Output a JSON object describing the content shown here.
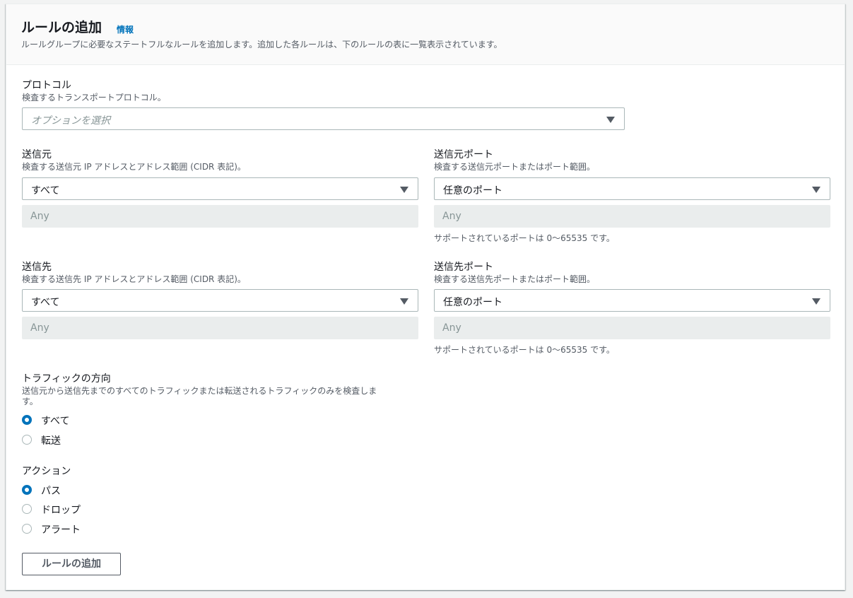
{
  "header": {
    "title": "ルールの追加",
    "info": "情報",
    "description": "ルールグループに必要なステートフルなルールを追加します。追加した各ルールは、下のルールの表に一覧表示されています。"
  },
  "protocol": {
    "label": "プロトコル",
    "description": "検査するトランスポートプロトコル。",
    "placeholder": "オプションを選択"
  },
  "source": {
    "label": "送信元",
    "description": "検査する送信元 IP アドレスとアドレス範囲 (CIDR 表記)。",
    "selected": "すべて",
    "disabled_value": "Any"
  },
  "source_port": {
    "label": "送信元ポート",
    "description": "検査する送信元ポートまたはポート範囲。",
    "selected": "任意のポート",
    "disabled_value": "Any",
    "hint": "サポートされているポートは 0〜65535 です。"
  },
  "destination": {
    "label": "送信先",
    "description": "検査する送信先 IP アドレスとアドレス範囲 (CIDR 表記)。",
    "selected": "すべて",
    "disabled_value": "Any"
  },
  "destination_port": {
    "label": "送信先ポート",
    "description": "検査する送信先ポートまたはポート範囲。",
    "selected": "任意のポート",
    "disabled_value": "Any",
    "hint": "サポートされているポートは 0〜65535 です。"
  },
  "traffic_direction": {
    "label": "トラフィックの方向",
    "description_line1": "送信元から送信先までのすべてのトラフィックまたは転送されるトラフィックのみを検査しま",
    "description_line2": "す。",
    "options": [
      {
        "label": "すべて",
        "checked": true
      },
      {
        "label": "転送",
        "checked": false
      }
    ]
  },
  "action": {
    "label": "アクション",
    "options": [
      {
        "label": "パス",
        "checked": true
      },
      {
        "label": "ドロップ",
        "checked": false
      },
      {
        "label": "アラート",
        "checked": false
      }
    ]
  },
  "add_rule_button": "ルールの追加",
  "colors": {
    "accent": "#0073bb",
    "text": "#16191f",
    "secondary_text": "#545b64",
    "disabled_bg": "#eaeded"
  }
}
